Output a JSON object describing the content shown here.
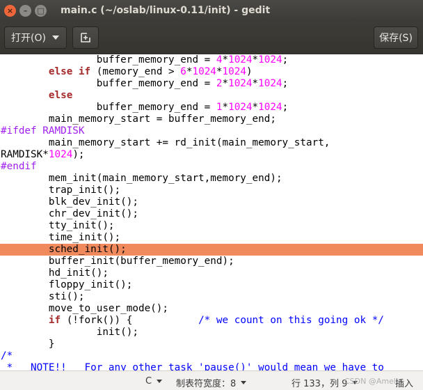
{
  "window": {
    "title": "main.c (~/oslab/linux-0.11/init) - gedit",
    "close_glyph": "×",
    "min_glyph": "–",
    "max_glyph": "□"
  },
  "header": {
    "open_label": "打开(O)",
    "save_label": "保存(S)"
  },
  "highlighted_line": 16,
  "code_lines": [
    [
      {
        "t": "                buffer_memory_end = "
      },
      {
        "t": "4",
        "c": "num"
      },
      {
        "t": "*"
      },
      {
        "t": "1024",
        "c": "num"
      },
      {
        "t": "*"
      },
      {
        "t": "1024",
        "c": "num"
      },
      {
        "t": ";"
      }
    ],
    [
      {
        "t": "        "
      },
      {
        "t": "else if",
        "c": "kw"
      },
      {
        "t": " (memory_end > "
      },
      {
        "t": "6",
        "c": "num"
      },
      {
        "t": "*"
      },
      {
        "t": "1024",
        "c": "num"
      },
      {
        "t": "*"
      },
      {
        "t": "1024",
        "c": "num"
      },
      {
        "t": ")"
      }
    ],
    [
      {
        "t": "                buffer_memory_end = "
      },
      {
        "t": "2",
        "c": "num"
      },
      {
        "t": "*"
      },
      {
        "t": "1024",
        "c": "num"
      },
      {
        "t": "*"
      },
      {
        "t": "1024",
        "c": "num"
      },
      {
        "t": ";"
      }
    ],
    [
      {
        "t": "        "
      },
      {
        "t": "else",
        "c": "kw"
      }
    ],
    [
      {
        "t": "                buffer_memory_end = "
      },
      {
        "t": "1",
        "c": "num"
      },
      {
        "t": "*"
      },
      {
        "t": "1024",
        "c": "num"
      },
      {
        "t": "*"
      },
      {
        "t": "1024",
        "c": "num"
      },
      {
        "t": ";"
      }
    ],
    [
      {
        "t": "        main_memory_start = buffer_memory_end;"
      }
    ],
    [
      {
        "t": "#ifdef RAMDISK",
        "c": "pp"
      }
    ],
    [
      {
        "t": "        main_memory_start += rd_init(main_memory_start,"
      }
    ],
    [
      {
        "t": "RAMDISK*"
      },
      {
        "t": "1024",
        "c": "num"
      },
      {
        "t": ");"
      }
    ],
    [
      {
        "t": "#endif",
        "c": "pp"
      }
    ],
    [
      {
        "t": "        mem_init(main_memory_start,memory_end);"
      }
    ],
    [
      {
        "t": "        trap_init();"
      }
    ],
    [
      {
        "t": "        blk_dev_init();"
      }
    ],
    [
      {
        "t": "        chr_dev_init();"
      }
    ],
    [
      {
        "t": "        tty_init();"
      }
    ],
    [
      {
        "t": "        time_init();"
      }
    ],
    [
      {
        "t": "        sched_init();"
      }
    ],
    [
      {
        "t": "        buffer_init(buffer_memory_end);"
      }
    ],
    [
      {
        "t": "        hd_init();"
      }
    ],
    [
      {
        "t": "        floppy_init();"
      }
    ],
    [
      {
        "t": "        sti();"
      }
    ],
    [
      {
        "t": "        move_to_user_mode();"
      }
    ],
    [
      {
        "t": "        "
      },
      {
        "t": "if",
        "c": "kw"
      },
      {
        "t": " (!fork()) {           "
      },
      {
        "t": "/* we count on this going ok */",
        "c": "cm"
      }
    ],
    [
      {
        "t": "                init();"
      }
    ],
    [
      {
        "t": "        }"
      }
    ],
    [
      {
        "t": "/*",
        "c": "cm"
      }
    ],
    [
      {
        "t": " *   NOTE!!   For any other task 'pause()' would mean we have to",
        "c": "cm"
      }
    ]
  ],
  "status": {
    "language": "C",
    "tab_width": "制表符宽度：8",
    "position": "行 133，列 9",
    "mode": "插入",
    "watermark": "CSDN @Amelia"
  },
  "colors": {
    "keyword": "#a52a2a",
    "number": "#ff00ff",
    "preprocessor": "#a020f0",
    "comment": "#0000ff",
    "current_line": "#f08a5d"
  }
}
